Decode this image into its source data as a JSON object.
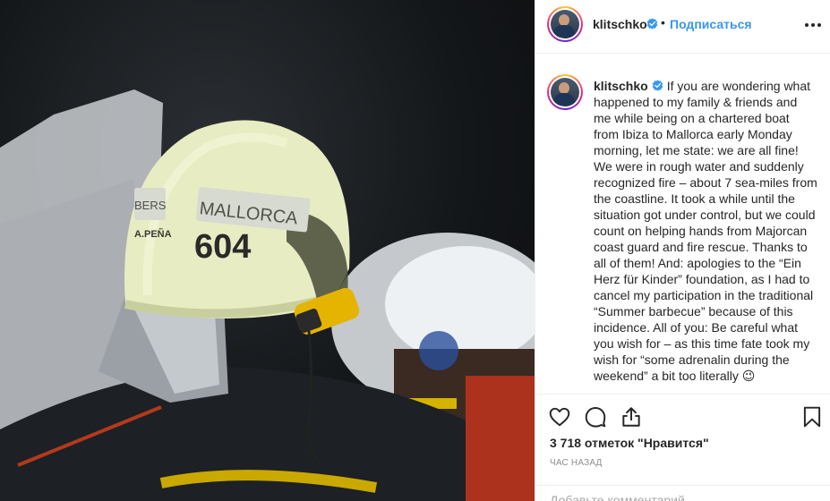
{
  "post": {
    "username": "klitschko",
    "follow_label": "Подписаться",
    "separator": "•",
    "caption": "If you are wondering what happened to my family & friends and me while being on a chartered boat from Ibiza to Mallorca early Monday morning, let me state: we are all fine! We were in rough water and suddenly recognized fire – about 7 sea-miles from the coastline. It took a while until the situation got under control, but we could count on helping hands from Majorcan coast guard and fire rescue. Thanks to all of them! And: apologies to the “Ein Herz für Kinder” foundation, as I had to cancel my participation in the traditional “Summer barbecue” because of this incidence. All of you: Be careful what you wish for – as this time fate took my wish for “some adrenalin during the weekend” a bit too literally 😉",
    "likes_text": "3 718 отметок \"Нравится\"",
    "time_ago": "час назад",
    "comment_placeholder": "Добавьте комментарий..."
  },
  "photo": {
    "helmet_text": "MALLORCA",
    "helmet_number": "604",
    "side_label": "BERS",
    "name_label": "A.PEÑA"
  },
  "icons": {
    "verified": "verified-badge-icon",
    "more": "more-options-icon",
    "like": "heart-icon",
    "comment": "comment-icon",
    "share": "share-icon",
    "save": "bookmark-icon"
  },
  "colors": {
    "link": "#3897f0",
    "verified": "#3897f0",
    "text": "#262626",
    "muted": "#8e8e8e"
  }
}
